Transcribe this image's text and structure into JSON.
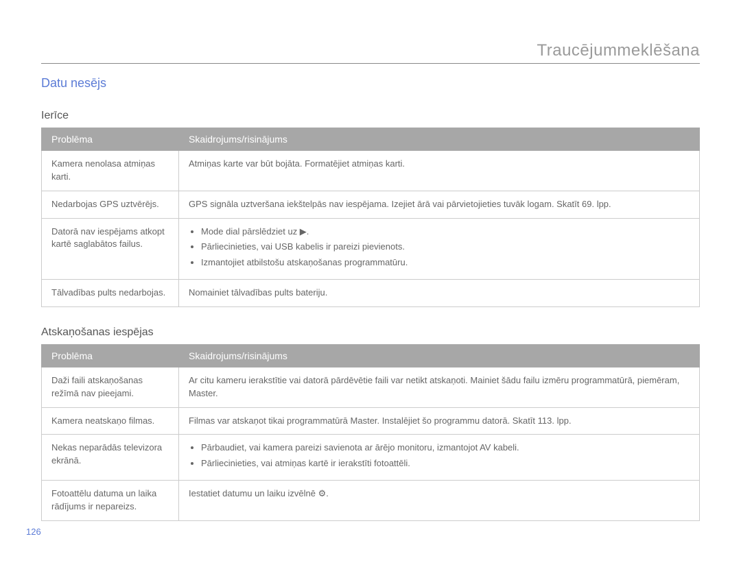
{
  "chapter": "Traucējummeklēšana",
  "section": "Datu nesējs",
  "sub1": "Ierīce",
  "sub2": "Atskaņošanas iespējas",
  "th_problem": "Problēma",
  "th_solution": "Skaidrojums/risinājums",
  "t1": {
    "r0": {
      "p": "Kamera nenolasa atmiņas karti.",
      "s": "Atmiņas karte var būt bojāta. Formatējiet atmiņas karti."
    },
    "r1": {
      "p": "Nedarbojas GPS uztvērējs.",
      "s": "GPS signāla uztveršana iekštelpās nav iespējama. Izejiet ārā vai pārvietojieties tuvāk logam. Skatīt 69. lpp."
    },
    "r2": {
      "p": "Datorā nav iespējams atkopt kartē saglabātos failus.",
      "s0": "Mode dial pārslēdziet uz ▶.",
      "s1": "Pārliecinieties, vai USB kabelis ir pareizi pievienots.",
      "s2": "Izmantojiet atbilstošu atskaņošanas programmatūru."
    },
    "r3": {
      "p": "Tālvadības pults nedarbojas.",
      "s": "Nomainiet tālvadības pults bateriju."
    }
  },
  "t2": {
    "r0": {
      "p": "Daži faili atskaņošanas režīmā nav pieejami.",
      "s": "Ar citu kameru ierakstītie vai datorā pārdēvētie faili var netikt atskaņoti. Mainiet šādu failu izmēru programmatūrā, piemēram, Master."
    },
    "r1": {
      "p": "Kamera neatskaņo filmas.",
      "s": "Filmas var atskaņot tikai programmatūrā Master. Instalējiet šo programmu datorā. Skatīt 113. lpp."
    },
    "r2": {
      "p": "Nekas neparādās televizora ekrānā.",
      "s0": "Pārbaudiet, vai kamera pareizi savienota ar ārējo monitoru, izmantojot AV kabeli.",
      "s1": "Pārliecinieties, vai atmiņas kartē ir ierakstīti fotoattēli."
    },
    "r3": {
      "p": "Fotoattēlu datuma un laika rādījums ir nepareizs.",
      "s": "Iestatiet datumu un laiku izvēlnē ⚙."
    }
  },
  "page_num": "126"
}
